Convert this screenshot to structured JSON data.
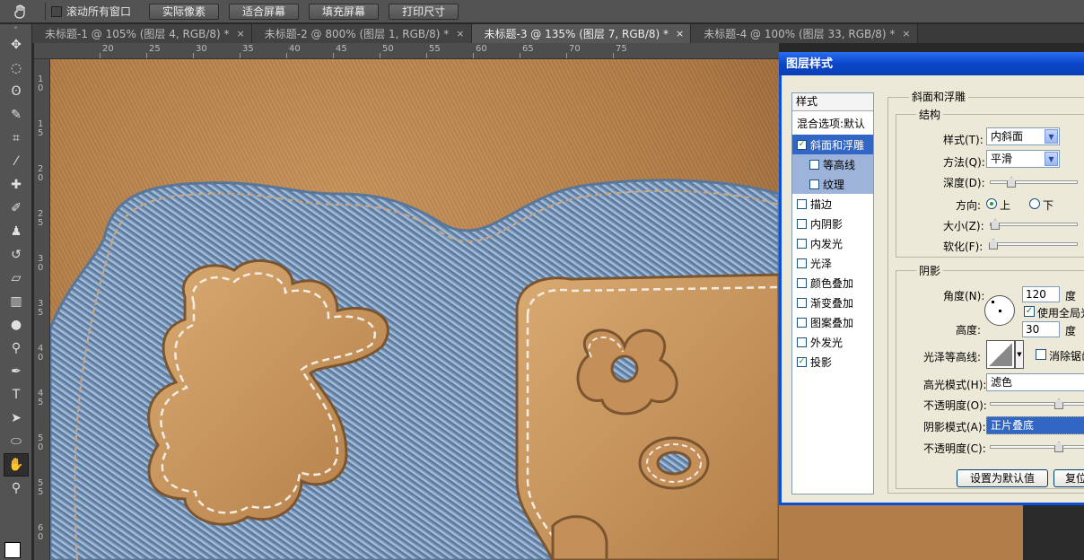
{
  "options_bar": {
    "hand_icon": "hand-icon",
    "scroll_all_windows": "滚动所有窗口",
    "buttons": [
      "实际像素",
      "适合屏幕",
      "填充屏幕",
      "打印尺寸"
    ]
  },
  "tabs": [
    {
      "label": "未标题-1 @ 105% (图层 4, RGB/8) *",
      "close": "×",
      "active": false
    },
    {
      "label": "未标题-2 @ 800% (图层 1, RGB/8) *",
      "close": "×",
      "active": false
    },
    {
      "label": "未标题-3 @ 135% (图层 7, RGB/8) *",
      "close": "×",
      "active": true
    },
    {
      "label": "未标题-4 @ 100% (图层 33, RGB/8) *",
      "close": "×",
      "active": false
    }
  ],
  "ruler": {
    "h_labels": [
      "20",
      "25",
      "30",
      "35",
      "40",
      "45",
      "50",
      "55",
      "60",
      "65",
      "70",
      "75"
    ],
    "v_labels": [
      "10",
      "15",
      "20",
      "25",
      "30",
      "35",
      "40",
      "45",
      "50",
      "55",
      "60"
    ]
  },
  "colors": {
    "accent": "#3166c5",
    "titlebar": "#0c46c9",
    "leather": "#b07a45",
    "denim": "#6f8fb3"
  },
  "dialog": {
    "title": "图层样式",
    "list_header": "样式",
    "blend_options": "混合选项:默认",
    "items": [
      {
        "label": "斜面和浮雕",
        "checked": true,
        "selected": true,
        "sub": false
      },
      {
        "label": "等高线",
        "checked": false,
        "selected": false,
        "sub": true
      },
      {
        "label": "纹理",
        "checked": false,
        "selected": false,
        "sub": true
      },
      {
        "label": "描边",
        "checked": false,
        "selected": false,
        "sub": false
      },
      {
        "label": "内阴影",
        "checked": false,
        "selected": false,
        "sub": false
      },
      {
        "label": "内发光",
        "checked": false,
        "selected": false,
        "sub": false
      },
      {
        "label": "光泽",
        "checked": false,
        "selected": false,
        "sub": false
      },
      {
        "label": "颜色叠加",
        "checked": false,
        "selected": false,
        "sub": false
      },
      {
        "label": "渐变叠加",
        "checked": false,
        "selected": false,
        "sub": false
      },
      {
        "label": "图案叠加",
        "checked": false,
        "selected": false,
        "sub": false
      },
      {
        "label": "外发光",
        "checked": false,
        "selected": false,
        "sub": false
      },
      {
        "label": "投影",
        "checked": true,
        "selected": false,
        "sub": false
      }
    ],
    "bevel": {
      "section_title": "斜面和浮雕",
      "structure_title": "结构",
      "style_label": "样式(T):",
      "style_value": "内斜面",
      "technique_label": "方法(Q):",
      "technique_value": "平滑",
      "depth_label": "深度(D):",
      "direction_label": "方向:",
      "dir_up": "上",
      "dir_down": "下",
      "size_label": "大小(Z):",
      "soften_label": "软化(F):",
      "shading_title": "阴影",
      "angle_label": "角度(N):",
      "angle_value": "120",
      "angle_unit": "度",
      "global_light": "使用全局光",
      "altitude_label": "高度:",
      "altitude_value": "30",
      "altitude_unit": "度",
      "gloss_label": "光泽等高线:",
      "anti_alias": "消除锯齿",
      "highlight_mode_label": "高光模式(H):",
      "highlight_mode_value": "滤色",
      "highlight_opacity_label": "不透明度(O):",
      "shadow_mode_label": "阴影模式(A):",
      "shadow_mode_value": "正片叠底",
      "shadow_opacity_label": "不透明度(C):",
      "make_default": "设置为默认值",
      "reset_default": "复位"
    }
  }
}
